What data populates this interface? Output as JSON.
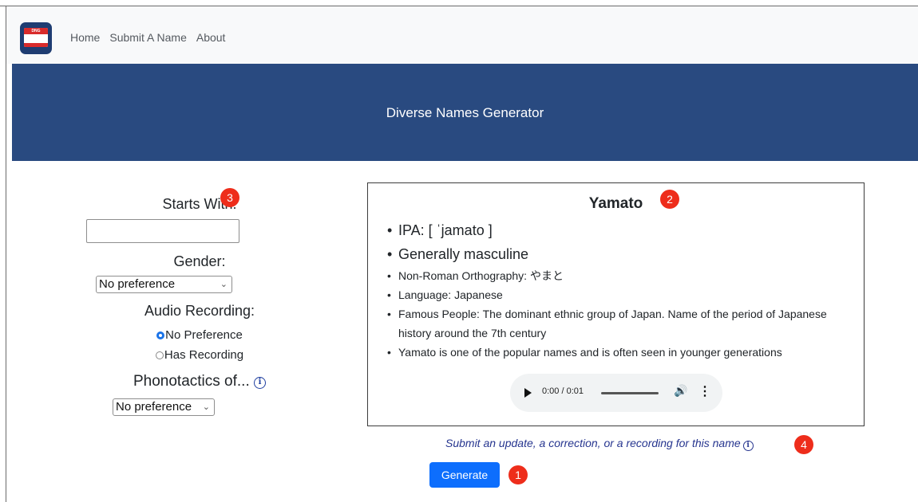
{
  "nav": {
    "logo_text": "DNG",
    "links": [
      "Home",
      "Submit A Name",
      "About"
    ]
  },
  "hero": {
    "title": "Diverse Names Generator"
  },
  "filters": {
    "starts_with_label": "Starts With:",
    "starts_with_value": "",
    "gender_label": "Gender:",
    "gender_selected": "No preference",
    "audio_label": "Audio Recording:",
    "audio_options": [
      "No Preference",
      "Has Recording"
    ],
    "audio_selected": "No Preference",
    "phonotactics_label": "Phonotactics of...",
    "phonotactics_selected": "No preference"
  },
  "result": {
    "name": "Yamato",
    "ipa": "IPA: [ ˈjamato ]",
    "gender": "Generally masculine",
    "orthography": "Non-Roman Orthography: やまと",
    "language": "Language: Japanese",
    "famous": "Famous People: The dominant ethnic group of Japan. Name of the period of Japanese history around the 7th century",
    "note": "Yamato is one of the popular names and is often seen in younger generations",
    "audio_time": "0:00 / 0:01"
  },
  "submit_link": "Submit an update, a correction, or a recording for this name",
  "generate_label": "Generate",
  "badges": [
    "1",
    "2",
    "3",
    "4"
  ],
  "colors": {
    "hero_bg": "#294a80",
    "button_bg": "#0d6efd",
    "badge_bg": "#ee2d1b",
    "link": "#26358f"
  }
}
